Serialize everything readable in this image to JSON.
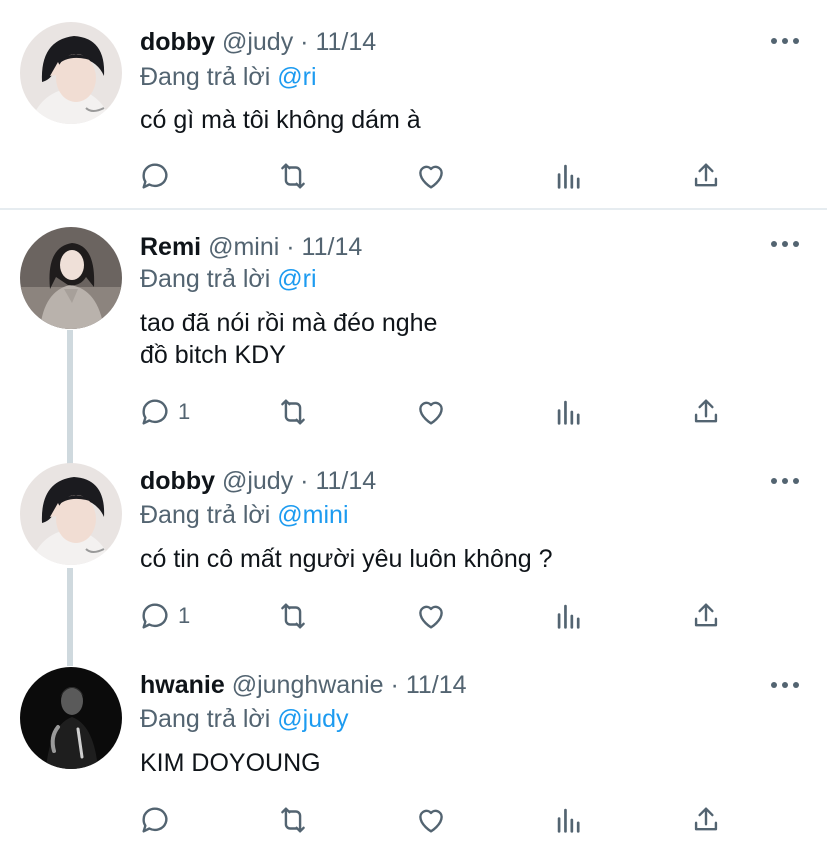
{
  "colors": {
    "text": "#0f1419",
    "muted": "#536471",
    "mention": "#1d9bf0",
    "thread_line": "#cfd9de",
    "divider": "#e6ecf0"
  },
  "reply_prefix": "Đang trả lời",
  "tweets": [
    {
      "name": "dobby",
      "handle": "@judy",
      "separator": "·",
      "date": "11/14",
      "mention": "@ri",
      "text": "có gì mà tôi không dám à",
      "reply_count": "",
      "avatar": "dobby-avatar"
    },
    {
      "name": "Remi",
      "handle": "@mini",
      "separator": "·",
      "date": "11/14",
      "mention": "@ri",
      "text": "tao đã nói rồi mà đéo nghe\nđồ bitch KDY",
      "reply_count": "1",
      "avatar": "remi-avatar"
    },
    {
      "name": "dobby",
      "handle": "@judy",
      "separator": "·",
      "date": "11/14",
      "mention": "@mini",
      "text": "có tin cô mất người yêu luôn không ?",
      "reply_count": "1",
      "avatar": "dobby-avatar"
    },
    {
      "name": "hwanie",
      "handle": "@junghwanie",
      "separator": "·",
      "date": "11/14",
      "mention": "@judy",
      "text": "KIM DOYOUNG",
      "reply_count": "",
      "avatar": "hwanie-avatar"
    }
  ],
  "icons": {
    "reply": "reply-icon",
    "retweet": "retweet-icon",
    "like": "heart-icon",
    "analytics": "analytics-icon",
    "share": "share-icon",
    "more": "more-icon"
  }
}
